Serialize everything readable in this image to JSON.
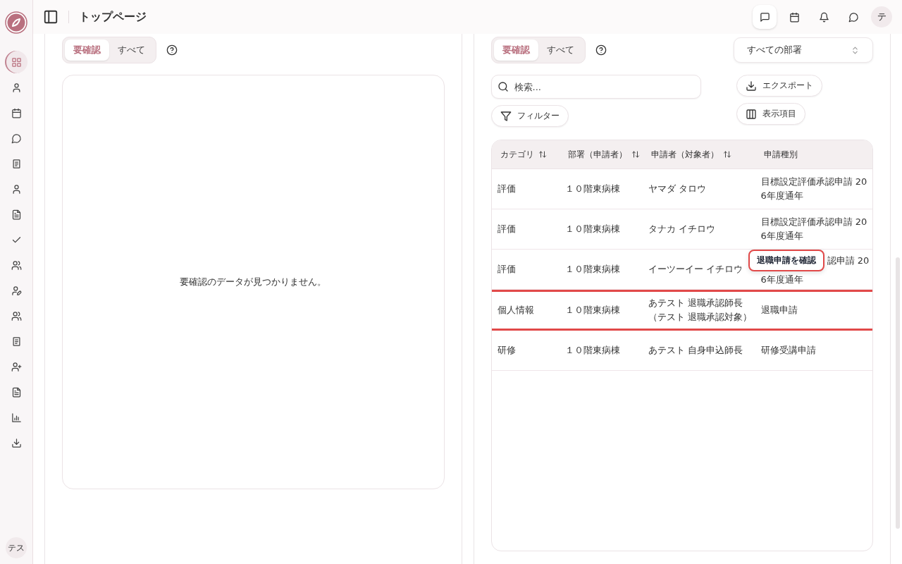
{
  "sidebar": {
    "items": [
      {
        "selected": true
      },
      {
        "selected": false
      },
      {
        "selected": false
      },
      {
        "selected": false
      },
      {
        "selected": false
      },
      {
        "selected": false
      },
      {
        "selected": false
      },
      {
        "selected": false
      },
      {
        "selected": false
      },
      {
        "selected": false
      },
      {
        "selected": false
      },
      {
        "selected": false
      },
      {
        "selected": false
      },
      {
        "selected": false
      },
      {
        "selected": false
      },
      {
        "selected": false
      }
    ],
    "user_avatar": "テス"
  },
  "header": {
    "title": "トップページ",
    "icons": [
      {
        "selected": true
      },
      {
        "selected": false
      },
      {
        "selected": false
      },
      {
        "selected": false
      }
    ],
    "avatar": "テ"
  },
  "left_panel": {
    "tabs": [
      {
        "label": "要確認",
        "selected": true
      },
      {
        "label": "すべて",
        "selected": false
      }
    ],
    "empty_message": "要確認のデータが見つかりません。"
  },
  "right_panel": {
    "tabs": [
      {
        "label": "要確認",
        "selected": true
      },
      {
        "label": "すべて",
        "selected": false
      }
    ],
    "department_select": {
      "value": "すべての部署"
    },
    "search": {
      "placeholder": "検索..."
    },
    "export_button": "エクスポート",
    "columns_button": "表示項目",
    "filter_button": "フィルター",
    "table": {
      "columns": [
        {
          "label": "カテゴリ",
          "sortable": true
        },
        {
          "label": "部署（申請者）",
          "sortable": true
        },
        {
          "label": "申請者（対象者）",
          "sortable": true
        },
        {
          "label": "申請種別",
          "sortable": false
        }
      ],
      "rows": [
        {
          "category": "評価",
          "department": "１０階東病棟",
          "applicant": [
            "ヤマダ タロウ"
          ],
          "type": [
            "目標設定評価承認申請 20",
            "6年度通年"
          ],
          "highlighted": false
        },
        {
          "category": "評価",
          "department": "１０階東病棟",
          "applicant": [
            "タナカ イチロウ"
          ],
          "type": [
            "目標設定評価承認申請 20",
            "6年度通年"
          ],
          "highlighted": false
        },
        {
          "category": "評価",
          "department": "１０階東病棟",
          "applicant": [
            "イーツーイー イチロウ"
          ],
          "type": [
            "認申請 20",
            "6年度通年"
          ],
          "highlighted": false,
          "covered": true
        },
        {
          "category": "個人情報",
          "department": "１０階東病棟",
          "applicant": [
            "あテスト 退職承認師長",
            "（テスト 退職承認対象）"
          ],
          "type": [
            "退職申請"
          ],
          "highlighted": true
        },
        {
          "category": "研修",
          "department": "１０階東病棟",
          "applicant": [
            "あテスト 自身申込師長"
          ],
          "type": [
            "研修受講申請"
          ],
          "highlighted": false
        }
      ]
    },
    "tooltip": {
      "text": "退職申請を確認"
    }
  }
}
